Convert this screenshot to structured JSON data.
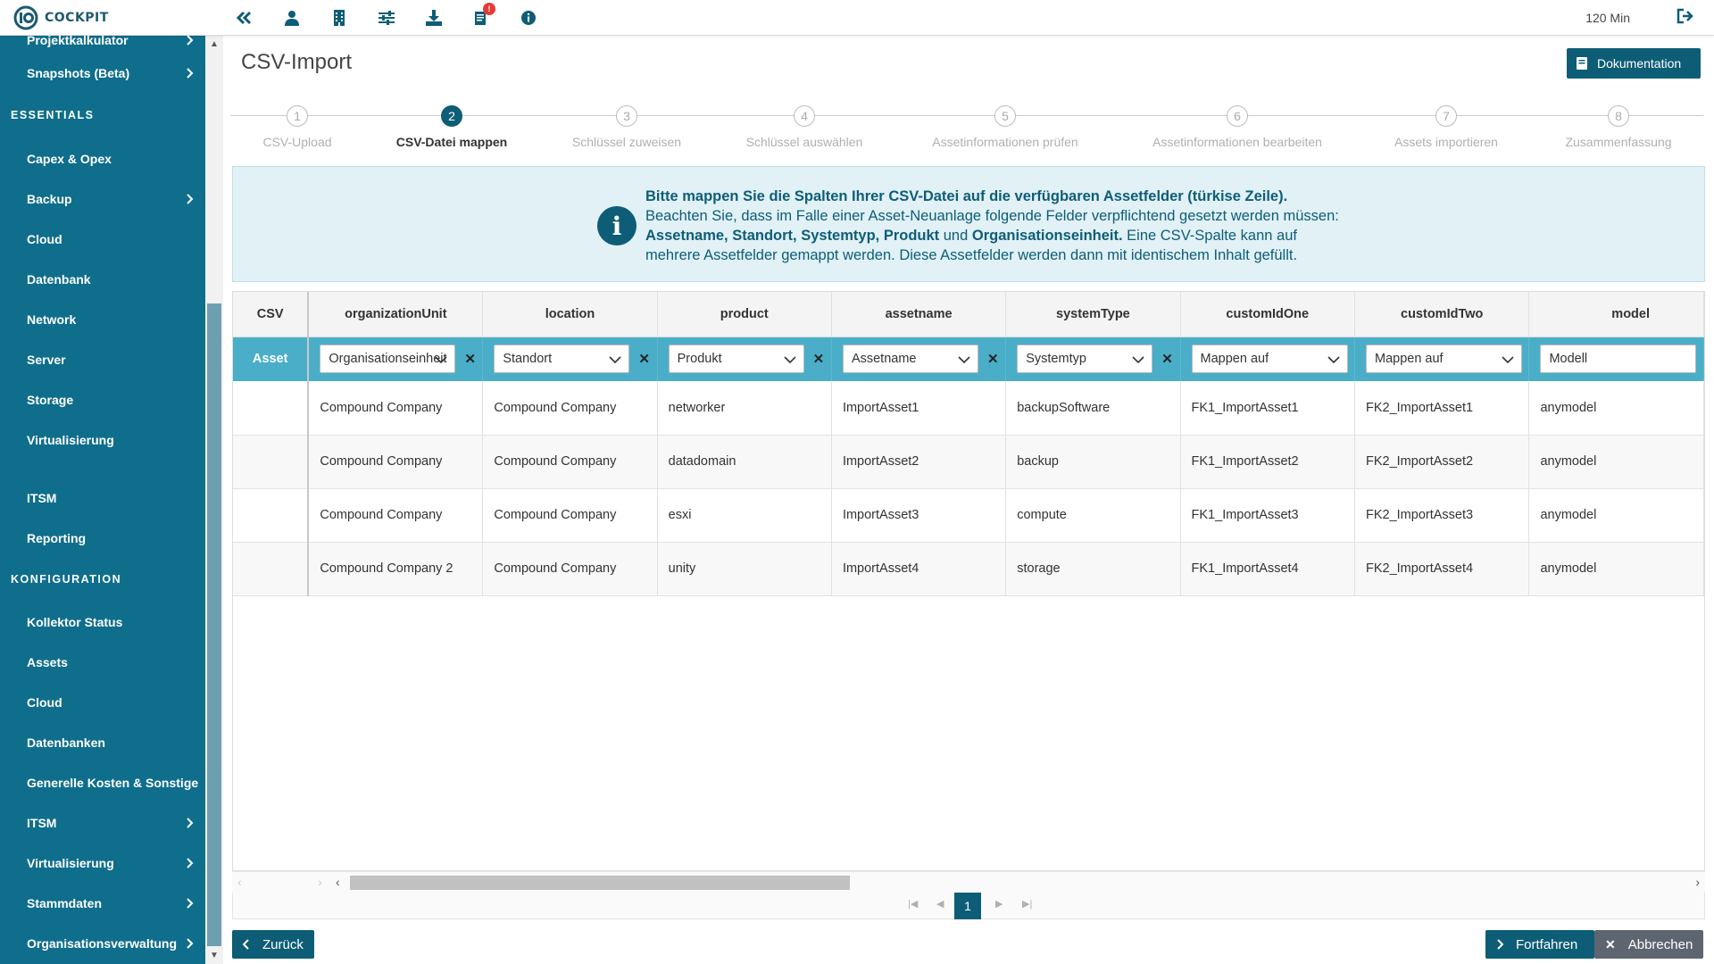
{
  "app": {
    "logo_text": "COCKPIT",
    "session_time": "120 Min",
    "notification_count": "!",
    "brand_color": "#0e5d77",
    "sidebar_color": "#0f6e8c",
    "mapping_row_color": "#4aaec8"
  },
  "topbar_icons": [
    "collapse-icon",
    "user-icon",
    "building-icon",
    "sliders-icon",
    "download-icon",
    "notifications-icon",
    "info-icon"
  ],
  "sidebar": {
    "items_top": [
      {
        "label": "Projektkalkulator",
        "has_children": true
      },
      {
        "label": "Snapshots (Beta)",
        "has_children": true
      }
    ],
    "section_essentials": "ESSENTIALS",
    "essentials": [
      {
        "label": "Capex & Opex",
        "has_children": false
      },
      {
        "label": "Backup",
        "has_children": true
      },
      {
        "label": "Cloud",
        "has_children": false
      },
      {
        "label": "Datenbank",
        "has_children": false
      },
      {
        "label": "Network",
        "has_children": false
      },
      {
        "label": "Server",
        "has_children": false
      },
      {
        "label": "Storage",
        "has_children": false
      },
      {
        "label": "Virtualisierung",
        "has_children": false
      },
      {
        "label": "ITSM",
        "has_children": false
      },
      {
        "label": "Reporting",
        "has_children": false
      }
    ],
    "section_konfiguration": "KONFIGURATION",
    "konfiguration": [
      {
        "label": "Kollektor Status",
        "has_children": false
      },
      {
        "label": "Assets",
        "has_children": false
      },
      {
        "label": "Cloud",
        "has_children": false
      },
      {
        "label": "Datenbanken",
        "has_children": false
      },
      {
        "label": "Generelle Kosten & Sonstige",
        "has_children": false
      },
      {
        "label": "ITSM",
        "has_children": true
      },
      {
        "label": "Virtualisierung",
        "has_children": true
      },
      {
        "label": "Stammdaten",
        "has_children": true
      },
      {
        "label": "Organisationsverwaltung",
        "has_children": true
      }
    ]
  },
  "page": {
    "title": "CSV-Import",
    "doc_button": "Dokumentation"
  },
  "stepper": {
    "active_step": 2,
    "steps": [
      {
        "num": "1",
        "label": "CSV-Upload"
      },
      {
        "num": "2",
        "label": "CSV-Datei mappen"
      },
      {
        "num": "3",
        "label": "Schlüssel zuweisen"
      },
      {
        "num": "4",
        "label": "Schlüssel auswählen"
      },
      {
        "num": "5",
        "label": "Assetinformationen prüfen"
      },
      {
        "num": "6",
        "label": "Assetinformationen bearbeiten"
      },
      {
        "num": "7",
        "label": "Assets importieren"
      },
      {
        "num": "8",
        "label": "Zusammenfassung"
      }
    ]
  },
  "info": {
    "line1": "Bitte mappen Sie die Spalten Ihrer CSV-Datei auf die verfügbaren Assetfelder (türkise Zeile).",
    "line2": "Beachten Sie, dass im Falle einer Asset-Neuanlage folgende Felder verpflichtend gesetzt werden müssen:",
    "line3_bold": "Assetname, Standort, Systemtyp, Produkt",
    "line3_und": " und ",
    "line3_bold2": "Organisationseinheit.",
    "line3_rest": " Eine CSV-Spalte kann auf",
    "line4": "mehrere Assetfelder gemappt werden. Diese Assetfelder werden dann mit identischem Inhalt gefüllt."
  },
  "table": {
    "csv_header": "CSV",
    "mapping_label": "Asset",
    "columns": [
      {
        "header": "organizationUnit",
        "mapping": "Organisationseinheit",
        "clearable": true
      },
      {
        "header": "location",
        "mapping": "Standort",
        "clearable": true
      },
      {
        "header": "product",
        "mapping": "Produkt",
        "clearable": true
      },
      {
        "header": "assetname",
        "mapping": "Assetname",
        "clearable": true
      },
      {
        "header": "systemType",
        "mapping": "Systemtyp",
        "clearable": true
      },
      {
        "header": "customIdOne",
        "mapping": "Mappen auf",
        "clearable": false
      },
      {
        "header": "customIdTwo",
        "mapping": "Mappen auf",
        "clearable": false
      },
      {
        "header": "model",
        "mapping": "Modell",
        "clearable": false
      }
    ],
    "rows": [
      [
        "Compound Company",
        "Compound Company",
        "networker",
        "ImportAsset1",
        "backupSoftware",
        "FK1_ImportAsset1",
        "FK2_ImportAsset1",
        "anymodel"
      ],
      [
        "Compound Company",
        "Compound Company",
        "datadomain",
        "ImportAsset2",
        "backup",
        "FK1_ImportAsset2",
        "FK2_ImportAsset2",
        "anymodel"
      ],
      [
        "Compound Company",
        "Compound Company",
        "esxi",
        "ImportAsset3",
        "compute",
        "FK1_ImportAsset3",
        "FK2_ImportAsset3",
        "anymodel"
      ],
      [
        "Compound Company 2",
        "Compound Company",
        "unity",
        "ImportAsset4",
        "storage",
        "FK1_ImportAsset4",
        "FK2_ImportAsset4",
        "anymodel"
      ]
    ]
  },
  "pagination": {
    "current_page": "1"
  },
  "footer": {
    "back": "Zurück",
    "continue": "Fortfahren",
    "cancel": "Abbrechen"
  }
}
